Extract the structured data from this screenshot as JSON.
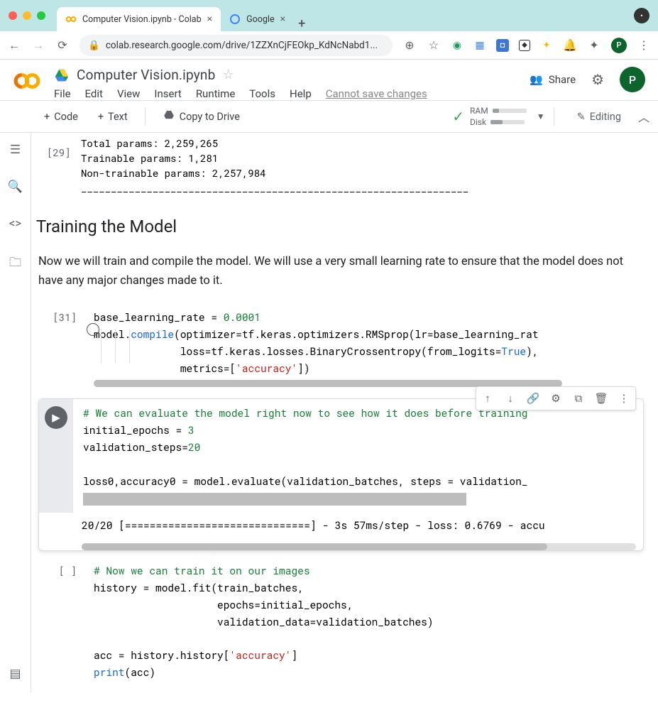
{
  "browser": {
    "tabs": [
      {
        "label": "Computer Vision.ipynb - Colab",
        "favicon": "colab",
        "active": true
      },
      {
        "label": "Google",
        "favicon": "google",
        "active": false
      }
    ],
    "url": "colab.research.google.com/drive/1ZZXnCjFEOkp_KdNcNabd1...",
    "avatar": "P"
  },
  "colab": {
    "drive_icon": "drive",
    "title": "Computer Vision.ipynb",
    "menus": [
      "File",
      "Edit",
      "View",
      "Insert",
      "Runtime",
      "Tools",
      "Help"
    ],
    "save_msg": "Cannot save changes",
    "share_label": "Share",
    "avatar": "P",
    "actions": {
      "code": "Code",
      "text": "Text",
      "copy_drive": "Copy to Drive",
      "editing": "Editing"
    },
    "resources": {
      "ram_label": "RAM",
      "disk_label": "Disk",
      "ram_pct": 20,
      "disk_pct": 35
    }
  },
  "notebook": {
    "output1": {
      "exec_num": "[29]",
      "lines": [
        "Total params: 2,259,265",
        "Trainable params: 1,281",
        "Non-trainable params: 2,257,984",
        "_________________________________________________________________"
      ]
    },
    "heading": "Training the Model",
    "paragraph": "Now we will train and compile the model. We will use a very small learning rate to ensure that the model does not have any major changes made to it.",
    "cell31": {
      "exec_num": "[31]",
      "code": "base_learning_rate = 0.0001\nmodel.compile(optimizer=tf.keras.optimizers.RMSprop(lr=base_learning_rat\n              loss=tf.keras.losses.BinaryCrossentropy(from_logits=True),\n              metrics=['accuracy'])"
    },
    "active_cell": {
      "code": "# We can evaluate the model right now to see how it does before training\ninitial_epochs = 3\nvalidation_steps=20\n\nloss0,accuracy0 = model.evaluate(validation_batches, steps = validation_",
      "output": "20/20 [==============================] - 3s 57ms/step - loss: 0.6769 - accu"
    },
    "cell_empty": {
      "exec_num": "[ ]",
      "code": "# Now we can train it on our images\nhistory = model.fit(train_batches,\n                    epochs=initial_epochs,\n                    validation_data=validation_batches)\n\nacc = history.history['accuracy']\nprint(acc)"
    }
  }
}
